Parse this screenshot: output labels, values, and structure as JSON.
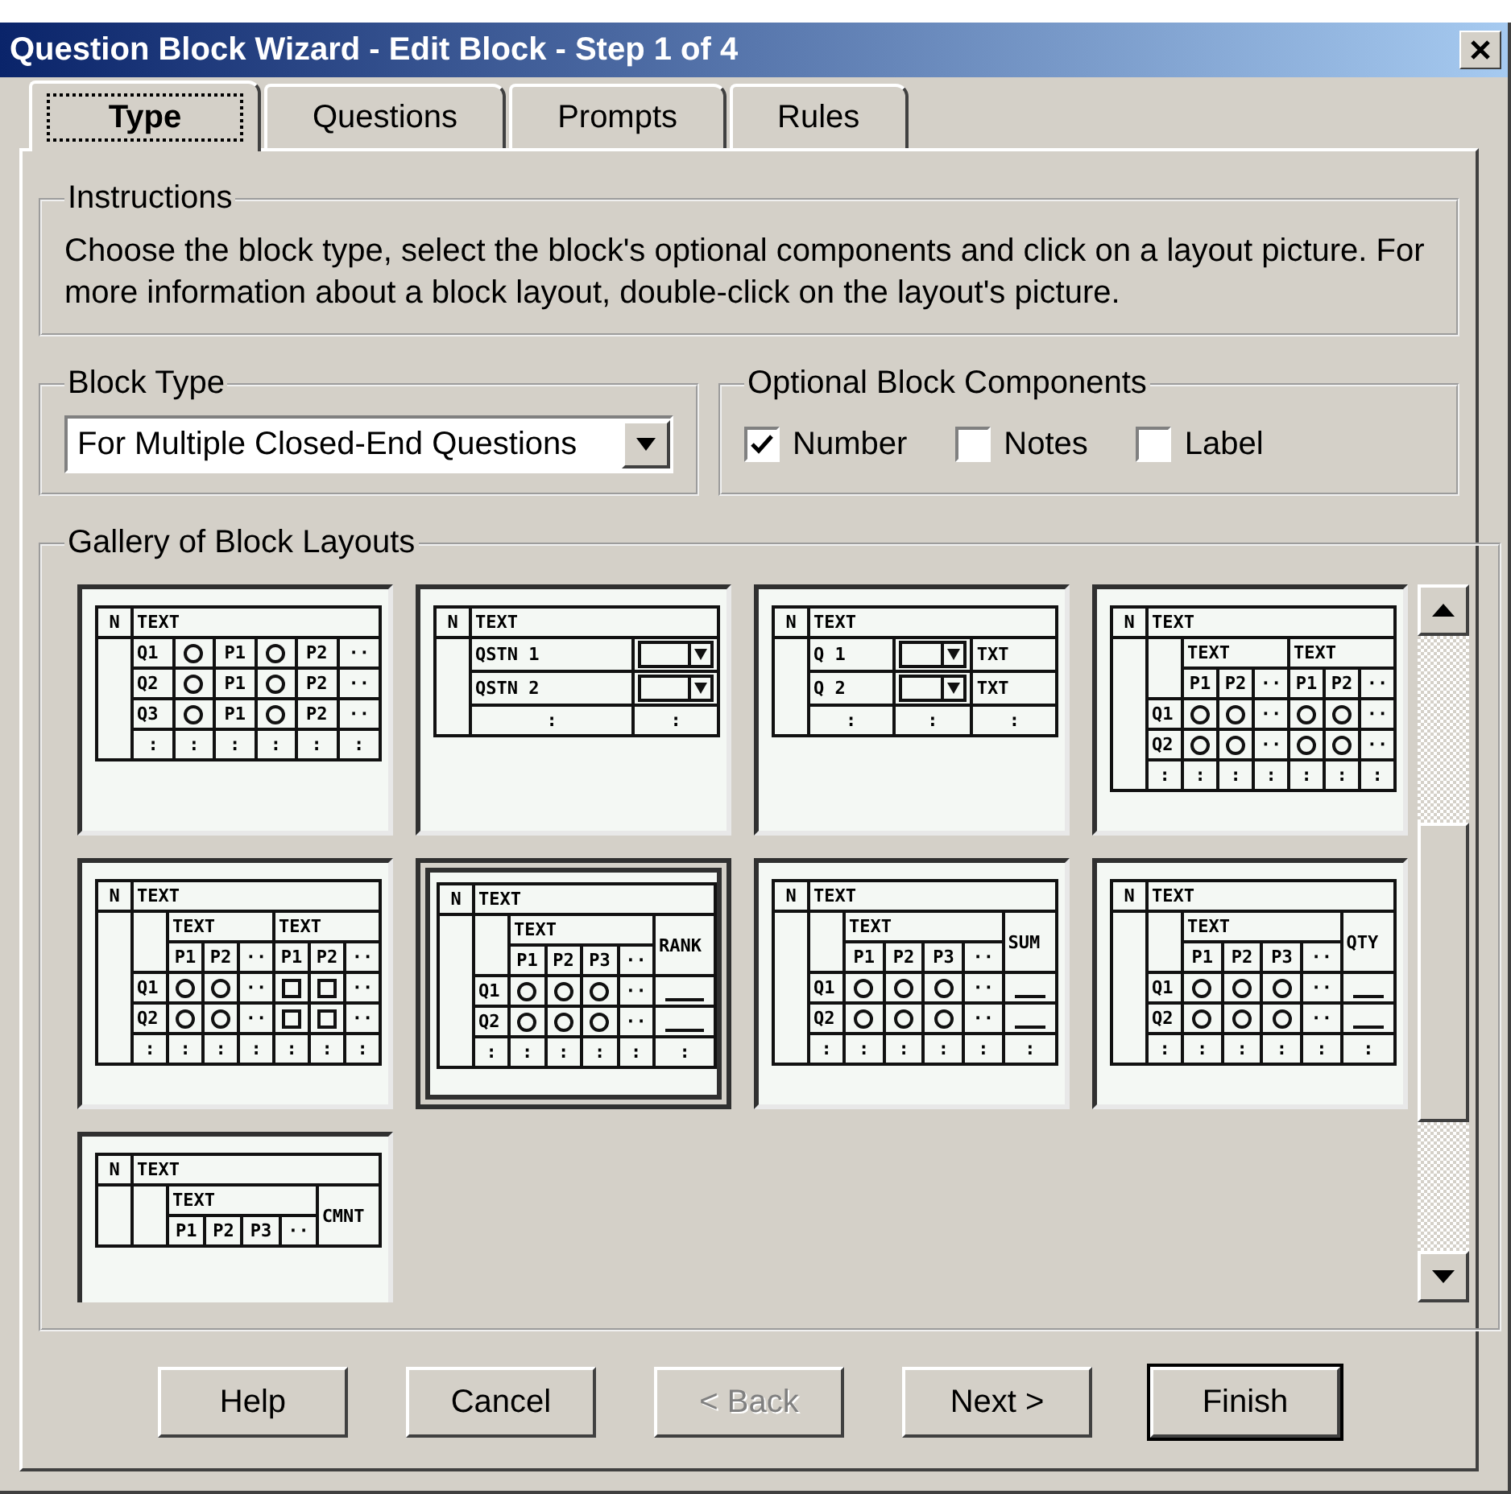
{
  "window": {
    "title": "Question Block Wizard - Edit Block - Step 1 of 4"
  },
  "tabs": [
    {
      "label": "Type",
      "selected": true
    },
    {
      "label": "Questions",
      "selected": false
    },
    {
      "label": "Prompts",
      "selected": false
    },
    {
      "label": "Rules",
      "selected": false
    }
  ],
  "instructions": {
    "label": "Instructions",
    "text": "Choose the block type, select the block's optional components and click on a layout picture. For more information about a block layout, double-click on the layout's picture."
  },
  "block_type": {
    "label": "Block Type",
    "value": "For Multiple Closed-End Questions"
  },
  "components": {
    "label": "Optional Block Components",
    "items": [
      {
        "label": "Number",
        "checked": true
      },
      {
        "label": "Notes",
        "checked": false
      },
      {
        "label": "Label",
        "checked": false
      }
    ]
  },
  "gallery": {
    "label": "Gallery of Block Layouts",
    "layouts": [
      {
        "selected": false,
        "rows": [
          [
            {
              "kind": "text",
              "text": "N"
            },
            {
              "kind": "text",
              "text": "TEXT",
              "colspan": 6
            }
          ],
          [
            {
              "kind": "empty",
              "rowspan": 4
            },
            {
              "kind": "text",
              "text": "Q1"
            },
            {
              "kind": "radio"
            },
            {
              "kind": "text",
              "text": "P1"
            },
            {
              "kind": "radio"
            },
            {
              "kind": "text",
              "text": "P2"
            },
            {
              "kind": "text",
              "text": "··"
            }
          ],
          [
            {
              "kind": "text",
              "text": "Q2"
            },
            {
              "kind": "radio"
            },
            {
              "kind": "text",
              "text": "P1"
            },
            {
              "kind": "radio"
            },
            {
              "kind": "text",
              "text": "P2"
            },
            {
              "kind": "text",
              "text": "··"
            }
          ],
          [
            {
              "kind": "text",
              "text": "Q3"
            },
            {
              "kind": "radio"
            },
            {
              "kind": "text",
              "text": "P1"
            },
            {
              "kind": "radio"
            },
            {
              "kind": "text",
              "text": "P2"
            },
            {
              "kind": "text",
              "text": "··"
            }
          ],
          [
            {
              "kind": "text",
              "text": ":"
            },
            {
              "kind": "text",
              "text": ":"
            },
            {
              "kind": "text",
              "text": ":"
            },
            {
              "kind": "text",
              "text": ":"
            },
            {
              "kind": "text",
              "text": ":"
            },
            {
              "kind": "text",
              "text": ":"
            }
          ]
        ]
      },
      {
        "selected": false,
        "rows": [
          [
            {
              "kind": "text",
              "text": "N"
            },
            {
              "kind": "text",
              "text": "TEXT",
              "colspan": 2
            }
          ],
          [
            {
              "kind": "empty",
              "rowspan": 3
            },
            {
              "kind": "text",
              "text": "QSTN 1"
            },
            {
              "kind": "dropdown"
            }
          ],
          [
            {
              "kind": "text",
              "text": "QSTN 2"
            },
            {
              "kind": "dropdown"
            }
          ],
          [
            {
              "kind": "text",
              "text": ":"
            },
            {
              "kind": "text",
              "text": ":"
            }
          ]
        ]
      },
      {
        "selected": false,
        "rows": [
          [
            {
              "kind": "text",
              "text": "N"
            },
            {
              "kind": "text",
              "text": "TEXT",
              "colspan": 3
            }
          ],
          [
            {
              "kind": "empty",
              "rowspan": 3
            },
            {
              "kind": "text",
              "text": "Q 1"
            },
            {
              "kind": "dropdown"
            },
            {
              "kind": "text",
              "text": "TXT"
            }
          ],
          [
            {
              "kind": "text",
              "text": "Q 2"
            },
            {
              "kind": "dropdown"
            },
            {
              "kind": "text",
              "text": "TXT"
            }
          ],
          [
            {
              "kind": "text",
              "text": ":"
            },
            {
              "kind": "text",
              "text": ":"
            },
            {
              "kind": "text",
              "text": ":"
            }
          ]
        ]
      },
      {
        "selected": false,
        "rows": [
          [
            {
              "kind": "text",
              "text": "N"
            },
            {
              "kind": "text",
              "text": "TEXT",
              "colspan": 7
            }
          ],
          [
            {
              "kind": "empty",
              "rowspan": 5
            },
            {
              "kind": "empty",
              "rowspan": 2
            },
            {
              "kind": "text",
              "text": "TEXT",
              "colspan": 3
            },
            {
              "kind": "text",
              "text": "TEXT",
              "colspan": 3
            }
          ],
          [
            {
              "kind": "text",
              "text": "P1"
            },
            {
              "kind": "text",
              "text": "P2"
            },
            {
              "kind": "text",
              "text": "··"
            },
            {
              "kind": "text",
              "text": "P1"
            },
            {
              "kind": "text",
              "text": "P2"
            },
            {
              "kind": "text",
              "text": "··"
            }
          ],
          [
            {
              "kind": "text",
              "text": "Q1"
            },
            {
              "kind": "radio"
            },
            {
              "kind": "radio"
            },
            {
              "kind": "text",
              "text": "··"
            },
            {
              "kind": "radio"
            },
            {
              "kind": "radio"
            },
            {
              "kind": "text",
              "text": "··"
            }
          ],
          [
            {
              "kind": "text",
              "text": "Q2"
            },
            {
              "kind": "radio"
            },
            {
              "kind": "radio"
            },
            {
              "kind": "text",
              "text": "··"
            },
            {
              "kind": "radio"
            },
            {
              "kind": "radio"
            },
            {
              "kind": "text",
              "text": "··"
            }
          ],
          [
            {
              "kind": "text",
              "text": ":"
            },
            {
              "kind": "text",
              "text": ":"
            },
            {
              "kind": "text",
              "text": ":"
            },
            {
              "kind": "text",
              "text": ":"
            },
            {
              "kind": "text",
              "text": ":"
            },
            {
              "kind": "text",
              "text": ":"
            },
            {
              "kind": "text",
              "text": ":"
            }
          ]
        ]
      },
      {
        "selected": false,
        "rows": [
          [
            {
              "kind": "text",
              "text": "N"
            },
            {
              "kind": "text",
              "text": "TEXT",
              "colspan": 7
            }
          ],
          [
            {
              "kind": "empty",
              "rowspan": 5
            },
            {
              "kind": "empty",
              "rowspan": 2
            },
            {
              "kind": "text",
              "text": "TEXT",
              "colspan": 3
            },
            {
              "kind": "text",
              "text": "TEXT",
              "colspan": 3
            }
          ],
          [
            {
              "kind": "text",
              "text": "P1"
            },
            {
              "kind": "text",
              "text": "P2"
            },
            {
              "kind": "text",
              "text": "··"
            },
            {
              "kind": "text",
              "text": "P1"
            },
            {
              "kind": "text",
              "text": "P2"
            },
            {
              "kind": "text",
              "text": "··"
            }
          ],
          [
            {
              "kind": "text",
              "text": "Q1"
            },
            {
              "kind": "radio"
            },
            {
              "kind": "radio"
            },
            {
              "kind": "text",
              "text": "··"
            },
            {
              "kind": "checkbox"
            },
            {
              "kind": "checkbox"
            },
            {
              "kind": "text",
              "text": "··"
            }
          ],
          [
            {
              "kind": "text",
              "text": "Q2"
            },
            {
              "kind": "radio"
            },
            {
              "kind": "radio"
            },
            {
              "kind": "text",
              "text": "··"
            },
            {
              "kind": "checkbox"
            },
            {
              "kind": "checkbox"
            },
            {
              "kind": "text",
              "text": "··"
            }
          ],
          [
            {
              "kind": "text",
              "text": ":"
            },
            {
              "kind": "text",
              "text": ":"
            },
            {
              "kind": "text",
              "text": ":"
            },
            {
              "kind": "text",
              "text": ":"
            },
            {
              "kind": "text",
              "text": ":"
            },
            {
              "kind": "text",
              "text": ":"
            },
            {
              "kind": "text",
              "text": ":"
            }
          ]
        ]
      },
      {
        "selected": true,
        "rows": [
          [
            {
              "kind": "text",
              "text": "N"
            },
            {
              "kind": "text",
              "text": "TEXT",
              "colspan": 6
            }
          ],
          [
            {
              "kind": "empty",
              "rowspan": 5
            },
            {
              "kind": "empty",
              "rowspan": 2
            },
            {
              "kind": "text",
              "text": "TEXT",
              "colspan": 4
            },
            {
              "kind": "text",
              "text": "RANK",
              "rowspan": 2
            }
          ],
          [
            {
              "kind": "text",
              "text": "P1"
            },
            {
              "kind": "text",
              "text": "P2"
            },
            {
              "kind": "text",
              "text": "P3"
            },
            {
              "kind": "text",
              "text": "··"
            }
          ],
          [
            {
              "kind": "text",
              "text": "Q1"
            },
            {
              "kind": "radio"
            },
            {
              "kind": "radio"
            },
            {
              "kind": "radio"
            },
            {
              "kind": "text",
              "text": "··"
            },
            {
              "kind": "blank"
            }
          ],
          [
            {
              "kind": "text",
              "text": "Q2"
            },
            {
              "kind": "radio"
            },
            {
              "kind": "radio"
            },
            {
              "kind": "radio"
            },
            {
              "kind": "text",
              "text": "··"
            },
            {
              "kind": "blank"
            }
          ],
          [
            {
              "kind": "text",
              "text": ":"
            },
            {
              "kind": "text",
              "text": ":"
            },
            {
              "kind": "text",
              "text": ":"
            },
            {
              "kind": "text",
              "text": ":"
            },
            {
              "kind": "text",
              "text": ":"
            },
            {
              "kind": "text",
              "text": ":"
            }
          ]
        ]
      },
      {
        "selected": false,
        "rows": [
          [
            {
              "kind": "text",
              "text": "N"
            },
            {
              "kind": "text",
              "text": "TEXT",
              "colspan": 6
            }
          ],
          [
            {
              "kind": "empty",
              "rowspan": 5
            },
            {
              "kind": "empty",
              "rowspan": 2
            },
            {
              "kind": "text",
              "text": "TEXT",
              "colspan": 4
            },
            {
              "kind": "text",
              "text": "SUM",
              "rowspan": 2
            }
          ],
          [
            {
              "kind": "text",
              "text": "P1"
            },
            {
              "kind": "text",
              "text": "P2"
            },
            {
              "kind": "text",
              "text": "P3"
            },
            {
              "kind": "text",
              "text": "··"
            }
          ],
          [
            {
              "kind": "text",
              "text": "Q1"
            },
            {
              "kind": "radio"
            },
            {
              "kind": "radio"
            },
            {
              "kind": "radio"
            },
            {
              "kind": "text",
              "text": "··"
            },
            {
              "kind": "blank"
            }
          ],
          [
            {
              "kind": "text",
              "text": "Q2"
            },
            {
              "kind": "radio"
            },
            {
              "kind": "radio"
            },
            {
              "kind": "radio"
            },
            {
              "kind": "text",
              "text": "··"
            },
            {
              "kind": "blank"
            }
          ],
          [
            {
              "kind": "text",
              "text": ":"
            },
            {
              "kind": "text",
              "text": ":"
            },
            {
              "kind": "text",
              "text": ":"
            },
            {
              "kind": "text",
              "text": ":"
            },
            {
              "kind": "text",
              "text": ":"
            },
            {
              "kind": "text",
              "text": ":"
            }
          ]
        ]
      },
      {
        "selected": false,
        "rows": [
          [
            {
              "kind": "text",
              "text": "N"
            },
            {
              "kind": "text",
              "text": "TEXT",
              "colspan": 6
            }
          ],
          [
            {
              "kind": "empty",
              "rowspan": 5
            },
            {
              "kind": "empty",
              "rowspan": 2
            },
            {
              "kind": "text",
              "text": "TEXT",
              "colspan": 4
            },
            {
              "kind": "text",
              "text": "QTY",
              "rowspan": 2
            }
          ],
          [
            {
              "kind": "text",
              "text": "P1"
            },
            {
              "kind": "text",
              "text": "P2"
            },
            {
              "kind": "text",
              "text": "P3"
            },
            {
              "kind": "text",
              "text": "··"
            }
          ],
          [
            {
              "kind": "text",
              "text": "Q1"
            },
            {
              "kind": "radio"
            },
            {
              "kind": "radio"
            },
            {
              "kind": "radio"
            },
            {
              "kind": "text",
              "text": "··"
            },
            {
              "kind": "blank"
            }
          ],
          [
            {
              "kind": "text",
              "text": "Q2"
            },
            {
              "kind": "radio"
            },
            {
              "kind": "radio"
            },
            {
              "kind": "radio"
            },
            {
              "kind": "text",
              "text": "··"
            },
            {
              "kind": "blank"
            }
          ],
          [
            {
              "kind": "text",
              "text": ":"
            },
            {
              "kind": "text",
              "text": ":"
            },
            {
              "kind": "text",
              "text": ":"
            },
            {
              "kind": "text",
              "text": ":"
            },
            {
              "kind": "text",
              "text": ":"
            },
            {
              "kind": "text",
              "text": ":"
            }
          ]
        ]
      },
      {
        "selected": false,
        "rows": [
          [
            {
              "kind": "text",
              "text": "N"
            },
            {
              "kind": "text",
              "text": "TEXT",
              "colspan": 6
            }
          ],
          [
            {
              "kind": "empty",
              "rowspan": 2
            },
            {
              "kind": "empty",
              "rowspan": 2
            },
            {
              "kind": "text",
              "text": "TEXT",
              "colspan": 4
            },
            {
              "kind": "text",
              "text": "CMNT",
              "rowspan": 2
            }
          ],
          [
            {
              "kind": "text",
              "text": "P1"
            },
            {
              "kind": "text",
              "text": "P2"
            },
            {
              "kind": "text",
              "text": "P3"
            },
            {
              "kind": "text",
              "text": "··"
            }
          ]
        ]
      }
    ]
  },
  "buttons": [
    {
      "label": "Help",
      "disabled": false,
      "default": false
    },
    {
      "label": "Cancel",
      "disabled": false,
      "default": false
    },
    {
      "label": "< Back",
      "disabled": true,
      "default": false
    },
    {
      "label": "Next >",
      "disabled": false,
      "default": false
    },
    {
      "label": "Finish",
      "disabled": false,
      "default": true
    }
  ]
}
